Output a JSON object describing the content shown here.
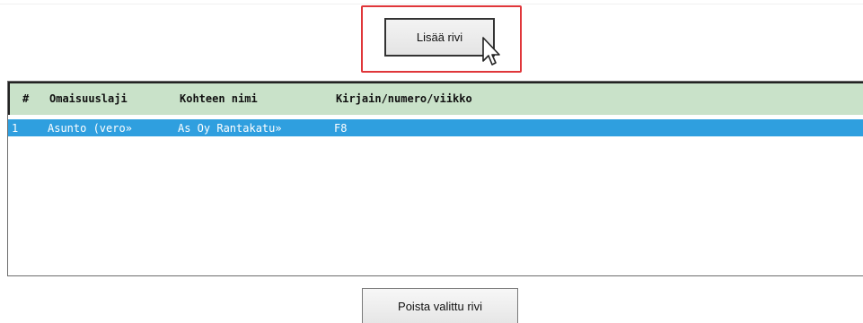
{
  "buttons": {
    "add_row": "Lisää rivi",
    "remove_selected_row": "Poista valittu rivi"
  },
  "table": {
    "columns": [
      "#",
      "Omaisuuslaji",
      "Kohteen nimi",
      "Kirjain/numero/viikko"
    ],
    "rows": [
      [
        "1",
        "Asunto (vero»",
        "As Oy Rantakatu»",
        "F8"
      ]
    ],
    "selected_row": 0
  },
  "annotations": {
    "highlight_color": "#e0363a",
    "selection_color": "#2f9fdf",
    "header_color": "#c9e2c9"
  },
  "icons": {
    "cursor": "mouse-pointer-icon"
  }
}
